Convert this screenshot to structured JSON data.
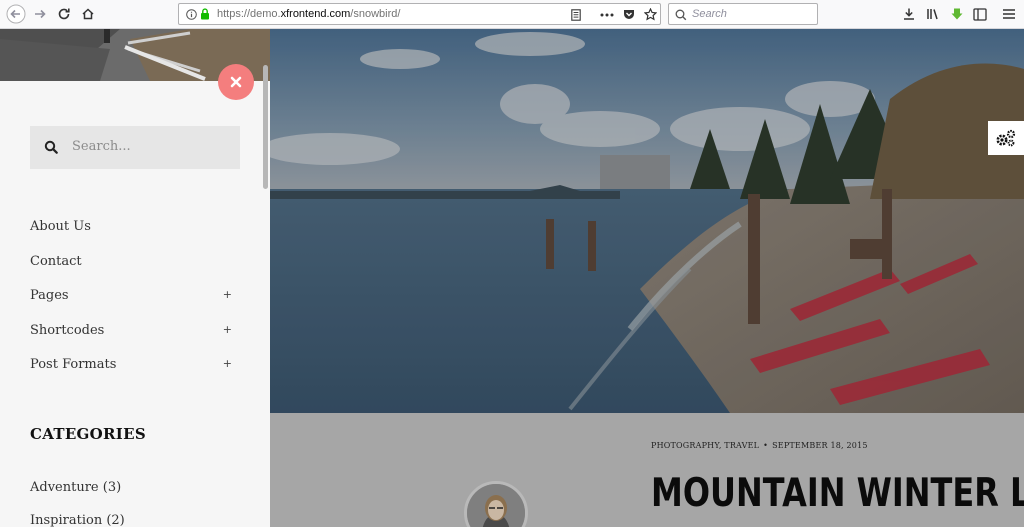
{
  "browser": {
    "url_prefix": "https://demo.",
    "url_domain": "xfrontend.com",
    "url_path": "/snowbird/",
    "search_placeholder": "Search"
  },
  "sidebar": {
    "search_placeholder": "Search...",
    "menu": [
      {
        "label": "About Us",
        "expandable": false
      },
      {
        "label": "Contact",
        "expandable": false
      },
      {
        "label": "Pages",
        "expandable": true
      },
      {
        "label": "Shortcodes",
        "expandable": true
      },
      {
        "label": "Post Formats",
        "expandable": true
      }
    ],
    "expand_symbol": "+",
    "categories_heading": "CATEGORIES",
    "categories": [
      {
        "label": "Adventure (3)"
      },
      {
        "label": "Inspiration (2)"
      }
    ]
  },
  "post": {
    "categories": "PHOTOGRAPHY, TRAVEL",
    "separator": "•",
    "date": "SEPTEMBER 18, 2015",
    "title": "MOUNTAIN WINTER LAND"
  },
  "colors": {
    "close_button": "#f47e7e",
    "sidebar_bg": "#f6f6f6",
    "content_overlay": "#a6a6a6"
  }
}
